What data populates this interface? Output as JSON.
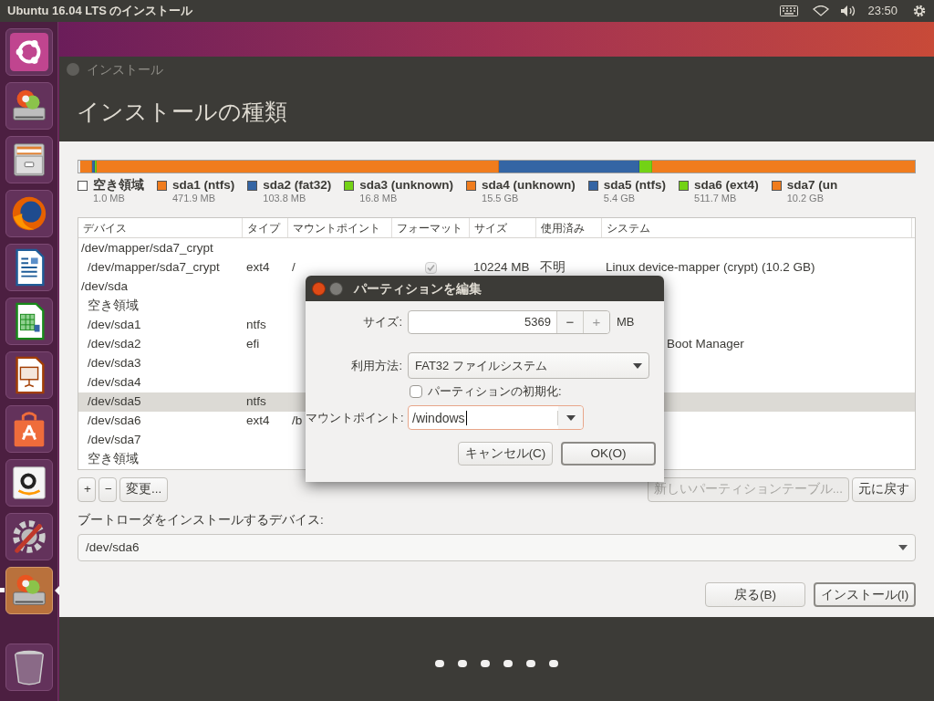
{
  "top_bar": {
    "title": "Ubuntu 16.04 LTS のインストール",
    "clock": "23:50"
  },
  "launcher": [
    {
      "kind": "dash",
      "focused": false
    },
    {
      "kind": "installer",
      "focused": false
    },
    {
      "kind": "files",
      "focused": false
    },
    {
      "kind": "browser",
      "focused": false
    },
    {
      "kind": "writer",
      "focused": false
    },
    {
      "kind": "calc",
      "focused": false
    },
    {
      "kind": "impress",
      "focused": false
    },
    {
      "kind": "software",
      "focused": false
    },
    {
      "kind": "amazon",
      "focused": false
    },
    {
      "kind": "settings",
      "focused": false
    },
    {
      "kind": "installer",
      "focused": true
    },
    {
      "kind": "trash",
      "focused": false
    }
  ],
  "window": {
    "title": "インストール",
    "heading": "インストールの種類"
  },
  "partitions": [
    {
      "name": "空き領域",
      "size": "1.0 MB",
      "color": "#ffffff"
    },
    {
      "name": "sda1 (ntfs)",
      "size": "471.9 MB",
      "color": "#f07c1d"
    },
    {
      "name": "sda2 (fat32)",
      "size": "103.8 MB",
      "color": "#3465a4"
    },
    {
      "name": "sda3 (unknown)",
      "size": "16.8 MB",
      "color": "#73d216"
    },
    {
      "name": "sda4 (unknown)",
      "size": "15.5 GB",
      "color": "#f07c1d"
    },
    {
      "name": "sda5 (ntfs)",
      "size": "5.4 GB",
      "color": "#3465a4"
    },
    {
      "name": "sda6 (ext4)",
      "size": "511.7 MB",
      "color": "#73d216"
    },
    {
      "name": "sda7 (un",
      "size": "10.2 GB",
      "color": "#f07c1d"
    }
  ],
  "table": {
    "columns": [
      "デバイス",
      "タイプ",
      "マウントポイント",
      "フォーマット",
      "サイズ",
      "使用済み",
      "システム"
    ],
    "rows": [
      {
        "device": "/dev/mapper/sda7_crypt",
        "selected": false,
        "children": [
          {
            "device": "/dev/mapper/sda7_crypt",
            "type": "ext4",
            "mount": "/",
            "format": true,
            "size": "10224 MB",
            "used": "不明",
            "system": "Linux device-mapper (crypt) (10.2 GB)",
            "selected": false
          }
        ]
      },
      {
        "device": "/dev/sda",
        "selected": false,
        "children": [
          {
            "device": "空き領域",
            "selected": false
          },
          {
            "device": "/dev/sda1",
            "type": "ntfs",
            "selected": false
          },
          {
            "device": "/dev/sda2",
            "type": "efi",
            "system": "Boot Manager",
            "selected": false
          },
          {
            "device": "/dev/sda3",
            "selected": false
          },
          {
            "device": "/dev/sda4",
            "selected": false
          },
          {
            "device": "/dev/sda5",
            "type": "ntfs",
            "selected": true
          },
          {
            "device": "/dev/sda6",
            "type": "ext4",
            "mount": "/b",
            "selected": false
          },
          {
            "device": "/dev/sda7",
            "selected": false
          },
          {
            "device": "空き領域",
            "selected": false
          }
        ]
      }
    ]
  },
  "table_buttons": [
    "+",
    "−",
    "変更..."
  ],
  "table_right_buttons": [
    {
      "label": "新しいパーティションテーブル...",
      "disabled": true
    },
    {
      "label": "元に戻す",
      "disabled": false
    }
  ],
  "bootloader": {
    "label": "ブートローダをインストールするデバイス:",
    "value": "/dev/sda6"
  },
  "nav_buttons": [
    {
      "label": "戻る(B)",
      "default": false
    },
    {
      "label": "インストール(I)",
      "default": true
    }
  ],
  "dialog": {
    "title": "パーティションを編集",
    "size_label": "サイズ:",
    "size_value": "5369",
    "size_minus": "−",
    "size_plus": "+",
    "size_unit": "MB",
    "use_label": "利用方法:",
    "use_value": "FAT32 ファイルシステム",
    "format_label": "パーティションの初期化:",
    "format_checked": false,
    "mount_label": "マウントポイント:",
    "mount_value": "/windows",
    "buttons": [
      {
        "label": "キャンセル(C)",
        "default": false
      },
      {
        "label": "OK(O)",
        "default": true
      }
    ]
  }
}
